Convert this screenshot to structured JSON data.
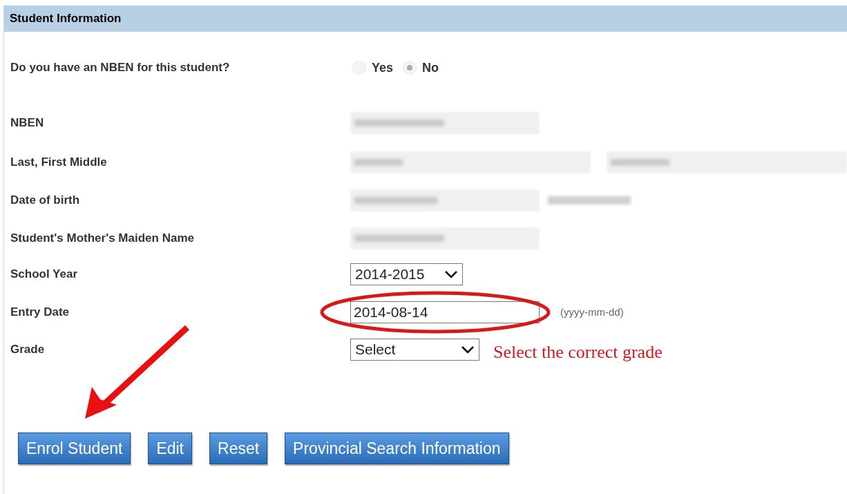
{
  "section": {
    "title": "Student Information"
  },
  "question": {
    "label": "Do you have an NBEN for this student?",
    "options": [
      {
        "label": "Yes",
        "selected": false
      },
      {
        "label": "No",
        "selected": true
      }
    ]
  },
  "fields": [
    {
      "label": "NBEN",
      "kind": "blurred"
    },
    {
      "label": "Last, First Middle",
      "kind": "blurred-pair"
    },
    {
      "label": "Date of birth",
      "kind": "blurred-hint"
    },
    {
      "label": "Student's Mother's Maiden Name",
      "kind": "blurred"
    },
    {
      "label": "School Year",
      "kind": "select",
      "value": "2014-2015"
    },
    {
      "label": "Entry Date",
      "kind": "text",
      "value": "2014-08-14",
      "hint": "(yyyy-mm-dd)",
      "circled": true
    },
    {
      "label": "Grade",
      "kind": "select-wide",
      "value": "Select",
      "note": "Select the correct grade"
    }
  ],
  "buttons": [
    {
      "label": "Enrol Student",
      "arrow": true
    },
    {
      "label": "Edit",
      "arrow": false
    },
    {
      "label": "Reset",
      "arrow": false
    },
    {
      "label": "Provincial Search Information",
      "arrow": false
    }
  ]
}
